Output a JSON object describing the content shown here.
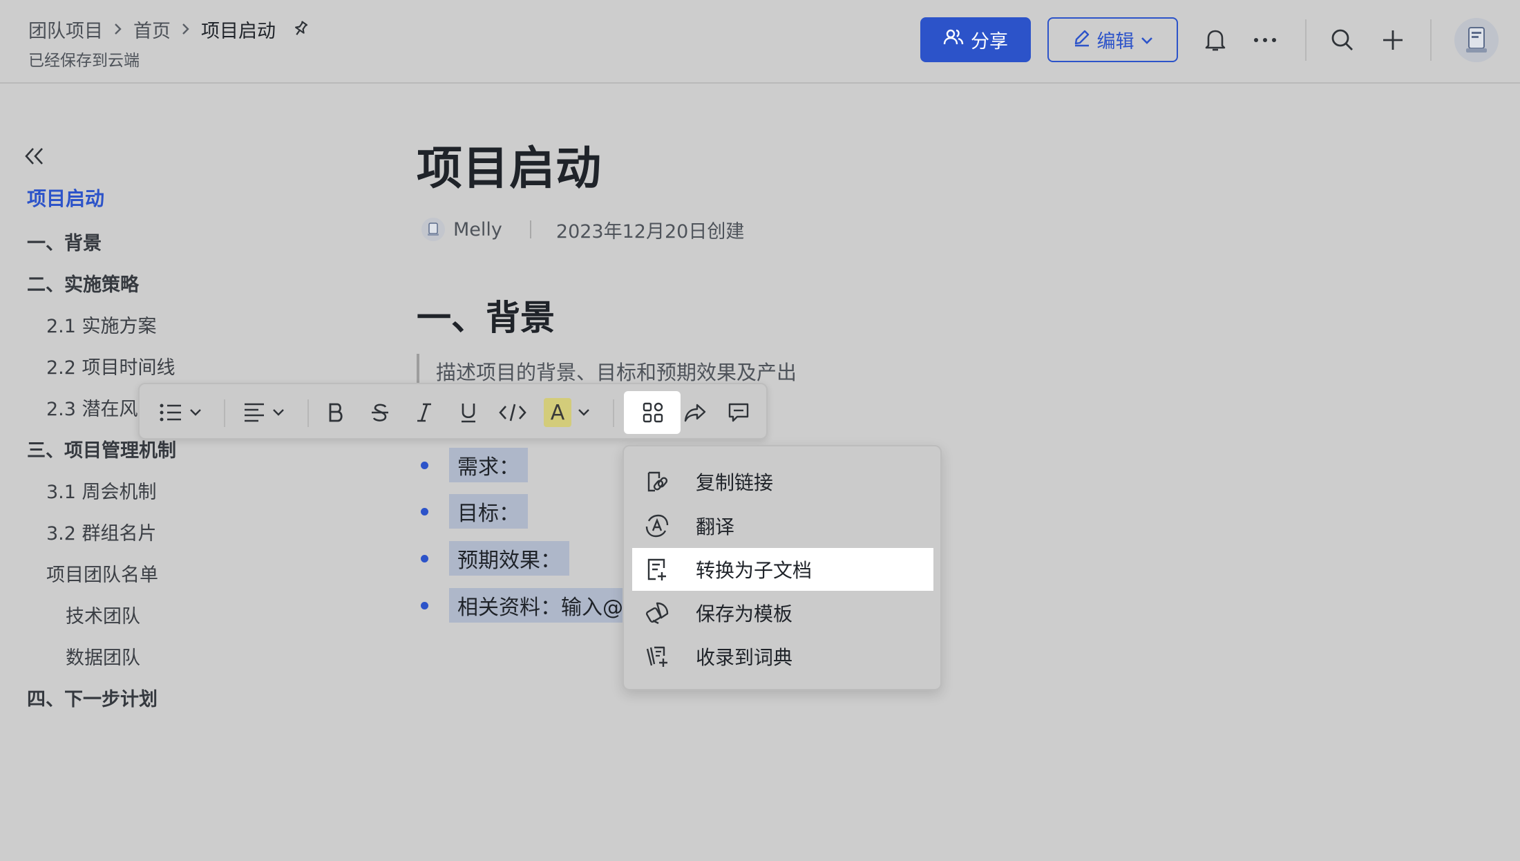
{
  "header": {
    "breadcrumb": [
      "团队项目",
      "首页",
      "项目启动"
    ],
    "saved_status": "已经保存到云端",
    "share_label": "分享",
    "edit_label": "编辑"
  },
  "toc": {
    "items": [
      {
        "label": "项目启动",
        "level": 0,
        "active": true
      },
      {
        "label": "一、背景",
        "level": 1
      },
      {
        "label": "二、实施策略",
        "level": 1
      },
      {
        "label": "2.1 实施方案",
        "level": 2
      },
      {
        "label": "2.2 项目时间线",
        "level": 2
      },
      {
        "label": "2.3 潜在风",
        "level": 2
      },
      {
        "label": "三、项目管理机制",
        "level": 1
      },
      {
        "label": "3.1 周会机制",
        "level": 2
      },
      {
        "label": "3.2 群组名片",
        "level": 2
      },
      {
        "label": "项目团队名单",
        "level": 2
      },
      {
        "label": "技术团队",
        "level": 3
      },
      {
        "label": "数据团队",
        "level": 3
      },
      {
        "label": "四、下一步计划",
        "level": 1
      }
    ]
  },
  "doc": {
    "title": "项目启动",
    "author": "Melly",
    "created": "2023年12月20日创建",
    "h2": "一、背景",
    "quote": "描述项目的背景、目标和预期效果及产出",
    "bullets": [
      "需求：",
      "目标：",
      "预期效果：",
      "相关资料：输入@"
    ]
  },
  "toolbar": {
    "highlight_letter": "A"
  },
  "menu": {
    "items": [
      {
        "label": "复制链接",
        "icon": "link-icon"
      },
      {
        "label": "翻译",
        "icon": "translate-icon"
      },
      {
        "label": "转换为子文档",
        "icon": "sub-doc-icon",
        "selected": true
      },
      {
        "label": "保存为模板",
        "icon": "template-icon"
      },
      {
        "label": "收录到词典",
        "icon": "dictionary-icon"
      }
    ]
  },
  "colors": {
    "accent": "#2c53c9",
    "background": "#cdcdcd",
    "selection": "#aeb7c9",
    "highlight": "#d3cc7a"
  }
}
